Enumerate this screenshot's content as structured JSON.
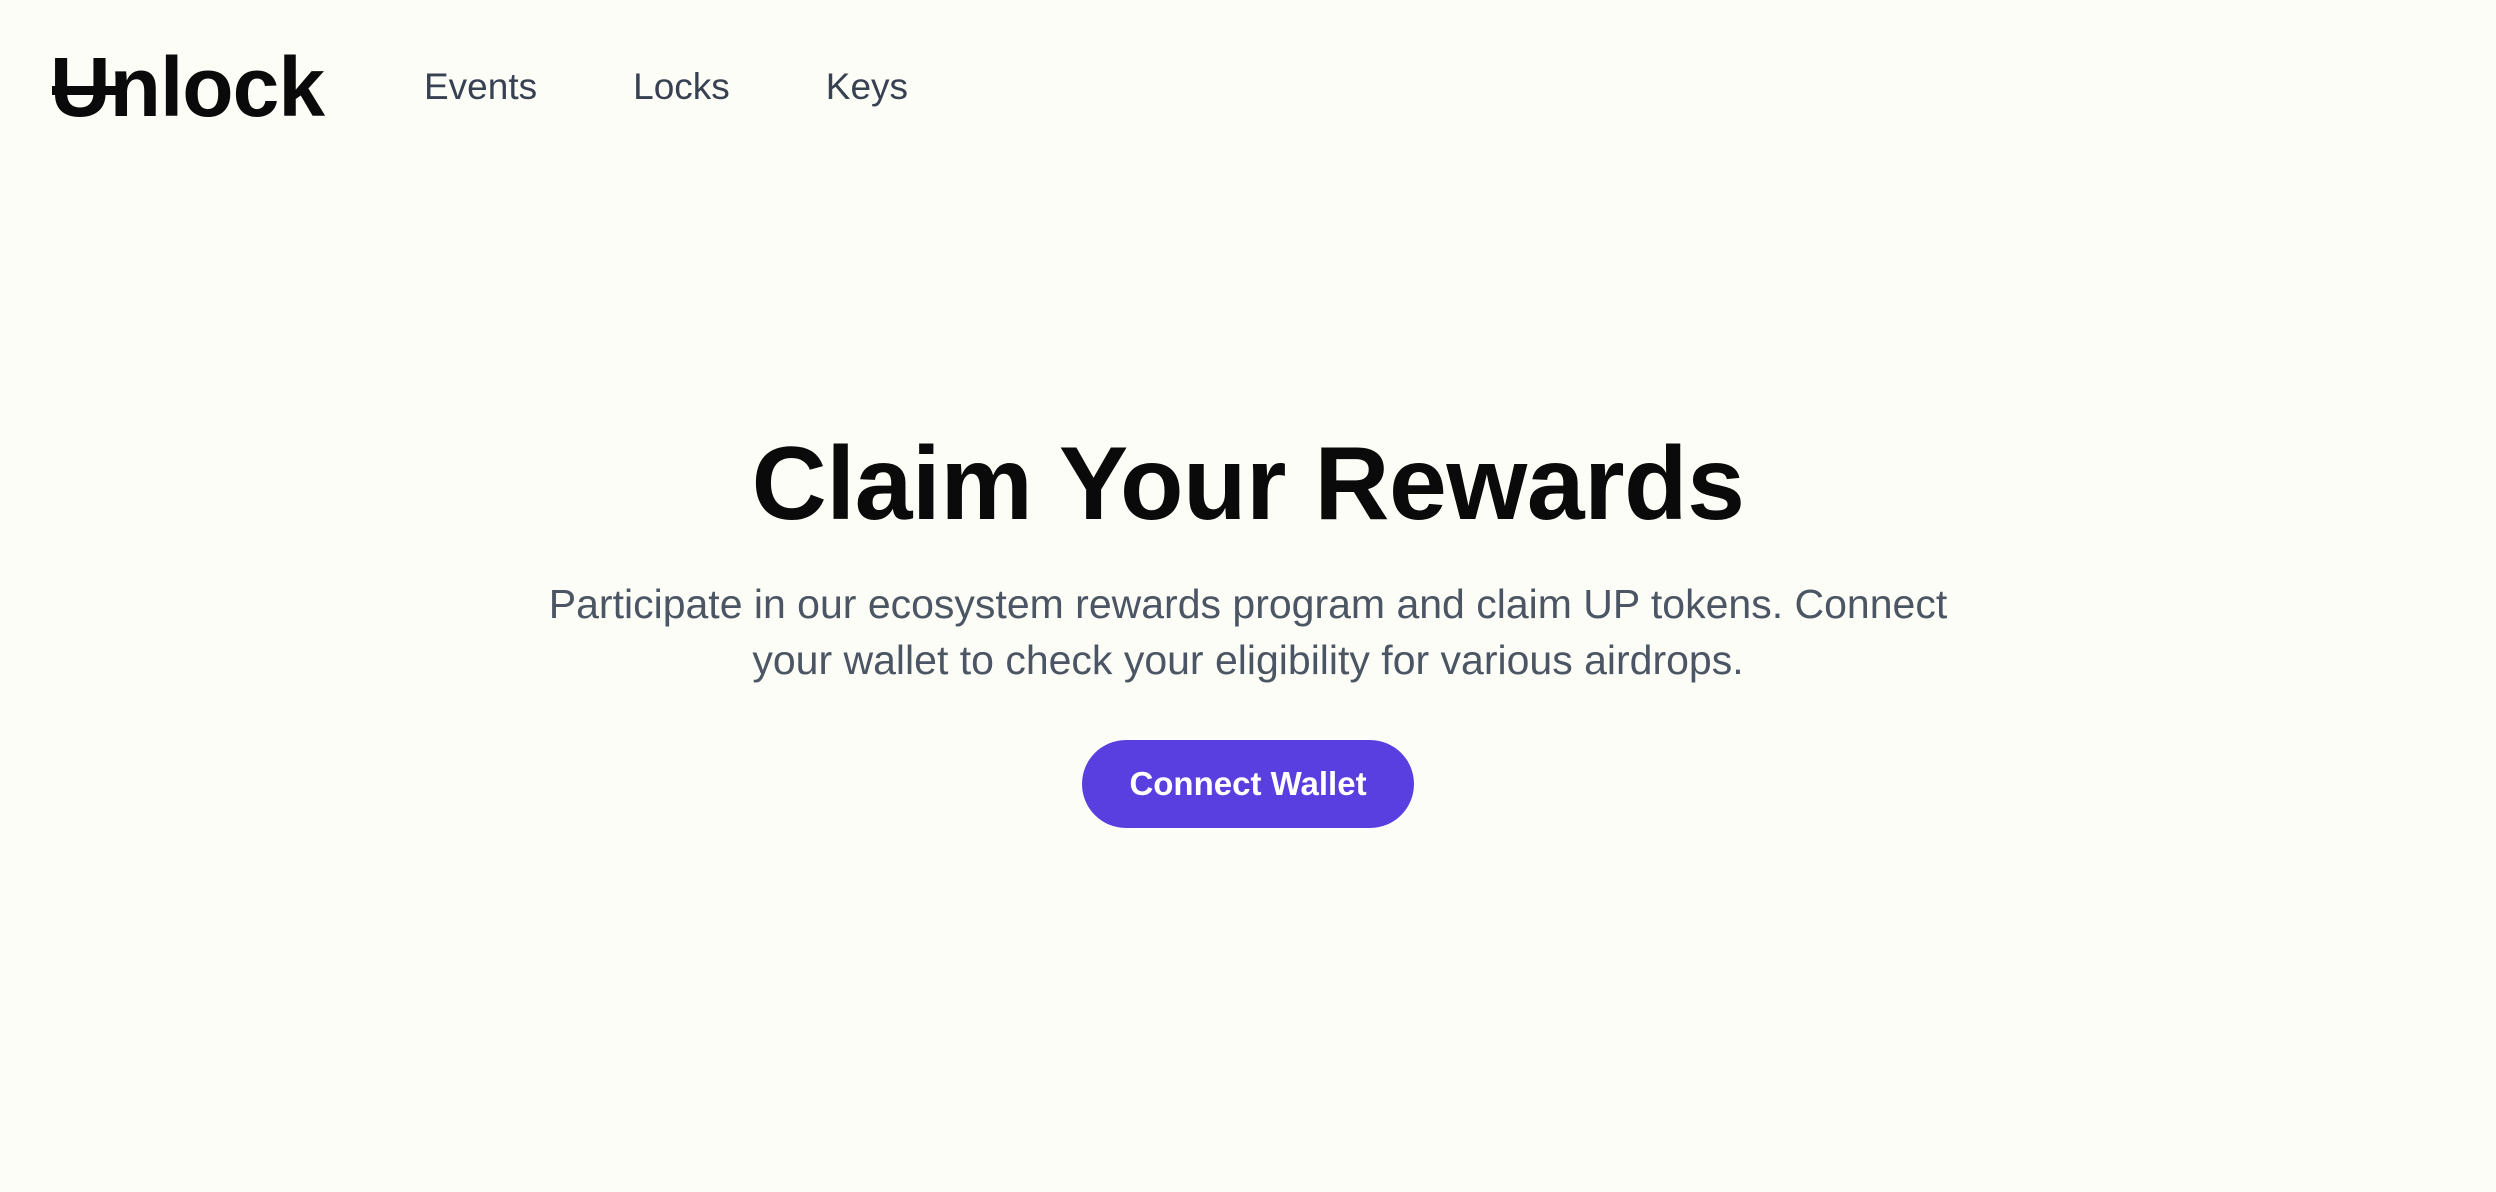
{
  "header": {
    "logo_text": "Unlock",
    "nav": [
      {
        "label": "Events"
      },
      {
        "label": "Locks"
      },
      {
        "label": "Keys"
      }
    ]
  },
  "hero": {
    "title": "Claim Your Rewards",
    "description": "Participate in our ecosystem rewards program and claim UP tokens. Connect your wallet to check your eligibility for various airdrops.",
    "cta_label": "Connect Wallet"
  },
  "colors": {
    "background": "#fdfdf8",
    "accent": "#5a3fe0",
    "heading": "#0a0a0a",
    "body_text": "#4b5563",
    "nav_text": "#374151"
  }
}
